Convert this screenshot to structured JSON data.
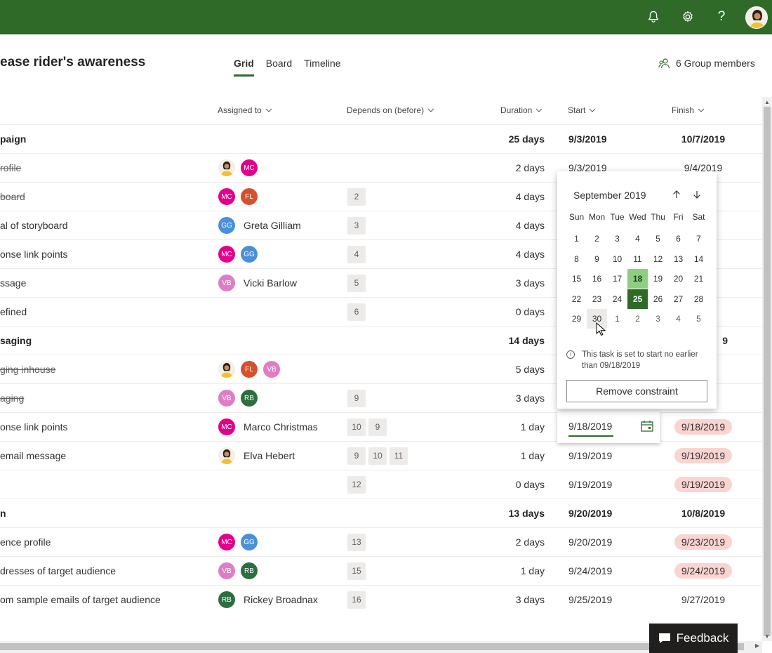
{
  "header": {
    "plan_title": "ease rider's awareness",
    "tabs": [
      {
        "label": "Grid",
        "active": true
      },
      {
        "label": "Board",
        "active": false
      },
      {
        "label": "Timeline",
        "active": false
      }
    ],
    "members_label": "6 Group members"
  },
  "columns": {
    "assigned_to": "Assigned to",
    "depends_on": "Depends on (before)",
    "duration": "Duration",
    "start": "Start",
    "finish": "Finish"
  },
  "colors": {
    "brand": "#2f6a29",
    "late": "#f9d4d0",
    "MC": "#e3008c",
    "FL": "#d5512b",
    "GG": "#4a8fd9",
    "VB": "#e07dc4",
    "RB": "#2b6e3f"
  },
  "rows": [
    {
      "name": "paign",
      "bucket": true,
      "duration": "25 days",
      "start": "9/3/2019",
      "finish": "10/7/2019"
    },
    {
      "name": "rofile",
      "done": true,
      "assignees": [
        "photo",
        "MC"
      ],
      "deps": [],
      "duration": "2 days",
      "start": "9/3/2019",
      "finish": "9/4/2019"
    },
    {
      "name": "board",
      "done": true,
      "assignees": [
        "MC",
        "FL"
      ],
      "deps": [
        "2"
      ],
      "duration": "4 days"
    },
    {
      "name": "al of storyboard",
      "assignees": [
        "GG"
      ],
      "assignee_name": "Greta Gilliam",
      "deps": [
        "3"
      ],
      "duration": "4 days"
    },
    {
      "name": "onse link points",
      "assignees": [
        "MC",
        "GG"
      ],
      "deps": [
        "4"
      ],
      "duration": "4 days"
    },
    {
      "name": "ssage",
      "assignees": [
        "VB"
      ],
      "assignee_name": "Vicki Barlow",
      "deps": [
        "5"
      ],
      "duration": "3 days"
    },
    {
      "name": "efined",
      "assignees": [],
      "deps": [
        "6"
      ],
      "duration": "0 days"
    },
    {
      "name": "saging",
      "bucket": true,
      "duration": "14 days",
      "finish": "9"
    },
    {
      "name": "ging inhouse",
      "done": true,
      "assignees": [
        "photo",
        "FL",
        "VB"
      ],
      "deps": [],
      "duration": "5 days"
    },
    {
      "name": "aging",
      "done": true,
      "assignees": [
        "VB",
        "RB"
      ],
      "deps": [
        "9"
      ],
      "duration": "3 days"
    },
    {
      "name": "onse link points",
      "assignees": [
        "MC"
      ],
      "assignee_name": "Marco Christmas",
      "deps": [
        "10",
        "9"
      ],
      "duration": "1 day",
      "finish": "9/18/2019",
      "late": true
    },
    {
      "name": "email message",
      "assignees": [
        "photo"
      ],
      "assignee_name": "Elva Hebert",
      "deps": [
        "9",
        "10",
        "11"
      ],
      "duration": "1 day",
      "start": "9/19/2019",
      "finish": "9/19/2019",
      "late": true
    },
    {
      "name": "",
      "assignees": [],
      "deps": [
        "12"
      ],
      "duration": "0 days",
      "start": "9/19/2019",
      "finish": "9/19/2019",
      "late": true
    },
    {
      "name": "n",
      "bucket": true,
      "duration": "13 days",
      "start": "9/20/2019",
      "finish": "10/8/2019"
    },
    {
      "name": "ence profile",
      "assignees": [
        "MC",
        "GG"
      ],
      "deps": [
        "13"
      ],
      "duration": "2 days",
      "start": "9/20/2019",
      "finish": "9/23/2019",
      "late": true
    },
    {
      "name": "dresses of target audience",
      "assignees": [
        "VB",
        "RB"
      ],
      "deps": [
        "15"
      ],
      "duration": "1 day",
      "start": "9/24/2019",
      "finish": "9/24/2019",
      "late": true
    },
    {
      "name": "om sample emails of target audience",
      "assignees": [
        "RB"
      ],
      "assignee_name": "Rickey Broadnax",
      "deps": [
        "16"
      ],
      "duration": "3 days",
      "start": "9/25/2019",
      "finish": "9/27/2019"
    }
  ],
  "date_edit": {
    "value": "9/18/2019"
  },
  "picker": {
    "month": "September 2019",
    "weekdays": [
      "Sun",
      "Mon",
      "Tue",
      "Wed",
      "Thu",
      "Fri",
      "Sat"
    ],
    "weeks": [
      [
        "1",
        "2",
        "3",
        "4",
        "5",
        "6",
        "7"
      ],
      [
        "8",
        "9",
        "10",
        "11",
        "12",
        "13",
        "14"
      ],
      [
        "15",
        "16",
        "17",
        "18",
        "19",
        "20",
        "21"
      ],
      [
        "22",
        "23",
        "24",
        "25",
        "26",
        "27",
        "28"
      ],
      [
        "29",
        "30",
        "1",
        "2",
        "3",
        "4",
        "5"
      ]
    ],
    "constraint_day": "18",
    "today_day": "25",
    "hover_day": "30",
    "info_text": "This task is set to start no earlier than 09/18/2019",
    "remove_label": "Remove constraint"
  },
  "feedback_label": "Feedback"
}
